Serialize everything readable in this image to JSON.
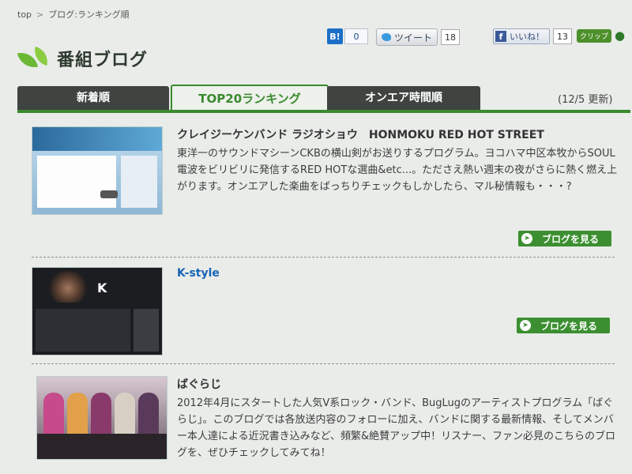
{
  "breadcrumb": {
    "items": [
      "top",
      "ブログ:ランキング順"
    ],
    "sep": ">"
  },
  "header": {
    "title": "番組ブログ"
  },
  "social": {
    "hatena_label": "B!",
    "hatena_count": "0",
    "tweet_label": "ツイート",
    "tweet_count": "18",
    "like_label": "いいね！",
    "like_count": "13",
    "clip_label": "クリップ"
  },
  "tabs": [
    {
      "label": "新着順",
      "active": false
    },
    {
      "label": "TOP20ランキング",
      "active": true
    },
    {
      "label": "オンエア時間順",
      "active": false
    }
  ],
  "updated": "(12/5 更新)",
  "entries": [
    {
      "title": "クレイジーケンバンド ラジオショウ　HONMOKU RED HOT STREET",
      "desc": "東洋一のサウンドマシーンCKBの横山剣がお送りするプログラム。ヨコハマ中区本牧からSOUL電波をビリビリに発信するRED HOTな選曲&etc...。たださえ熱い週末の夜がさらに熱く燃え上がります。オンエアした楽曲をばっちりチェックもしかしたら、マル秘情報も・・・?",
      "button": "ブログを見る"
    },
    {
      "title": "K-style",
      "desc": "",
      "button": "ブログを見る"
    },
    {
      "title": "ばぐらじ",
      "desc": "2012年4月にスタートした人気V系ロック・バンド、BugLugのアーティストプログラム「ばぐらじ」。このブログでは各放送内容のフォローに加え、バンドに関する最新情報、そしてメンバー本人達による近況書き込みなど、頻繁&絶賛アップ中！リスナー、ファン必見のこちらのブログを、ぜひチェックしてみてね！",
      "button": ""
    }
  ],
  "colors": {
    "accent_green": "#3a8a2e",
    "tab_dark": "#3f4440",
    "link_blue": "#1a64b8"
  }
}
